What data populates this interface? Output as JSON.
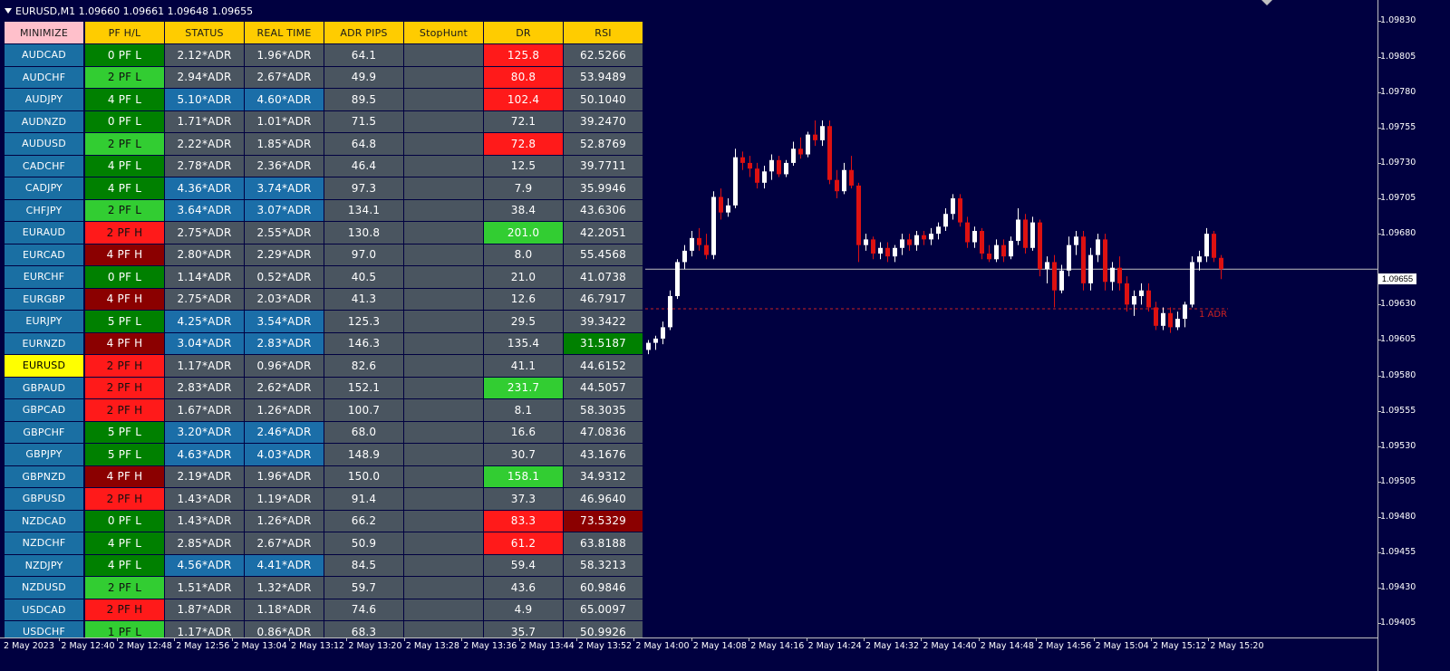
{
  "window": {
    "title": "EURUSD,M1  1.09660 1.09661 1.09648 1.09655"
  },
  "table": {
    "headers": [
      "MINIMIZE",
      "PF H/L",
      "STATUS",
      "REAL TIME",
      "ADR PIPS",
      "StopHunt",
      "DR",
      "RSI"
    ],
    "rows": [
      {
        "symbol": "AUDCAD",
        "pf": "0 PF L",
        "pf_color": "dg",
        "status": "2.12*ADR",
        "status_color": "gray",
        "realtime": "1.96*ADR",
        "realtime_color": "gray",
        "adr": "64.1",
        "stophunt": "",
        "dr": "125.8",
        "dr_color": "red",
        "rsi": "62.5266",
        "rsi_color": "gray"
      },
      {
        "symbol": "AUDCHF",
        "pf": "2 PF L",
        "pf_color": "lg",
        "status": "2.94*ADR",
        "status_color": "gray",
        "realtime": "2.67*ADR",
        "realtime_color": "gray",
        "adr": "49.9",
        "stophunt": "",
        "dr": "80.8",
        "dr_color": "red",
        "rsi": "53.9489",
        "rsi_color": "gray"
      },
      {
        "symbol": "AUDJPY",
        "pf": "4 PF L",
        "pf_color": "dg",
        "status": "5.10*ADR",
        "status_color": "blue",
        "realtime": "4.60*ADR",
        "realtime_color": "blue",
        "adr": "89.5",
        "stophunt": "",
        "dr": "102.4",
        "dr_color": "red",
        "rsi": "50.1040",
        "rsi_color": "gray"
      },
      {
        "symbol": "AUDNZD",
        "pf": "0 PF L",
        "pf_color": "dg",
        "status": "1.71*ADR",
        "status_color": "gray",
        "realtime": "1.01*ADR",
        "realtime_color": "gray",
        "adr": "71.5",
        "stophunt": "",
        "dr": "72.1",
        "dr_color": "gray",
        "rsi": "39.2470",
        "rsi_color": "gray"
      },
      {
        "symbol": "AUDUSD",
        "pf": "2 PF L",
        "pf_color": "lg",
        "status": "2.22*ADR",
        "status_color": "gray",
        "realtime": "1.85*ADR",
        "realtime_color": "gray",
        "adr": "64.8",
        "stophunt": "",
        "dr": "72.8",
        "dr_color": "red",
        "rsi": "52.8769",
        "rsi_color": "gray"
      },
      {
        "symbol": "CADCHF",
        "pf": "4 PF L",
        "pf_color": "dg",
        "status": "2.78*ADR",
        "status_color": "gray",
        "realtime": "2.36*ADR",
        "realtime_color": "gray",
        "adr": "46.4",
        "stophunt": "",
        "dr": "12.5",
        "dr_color": "gray",
        "rsi": "39.7711",
        "rsi_color": "gray"
      },
      {
        "symbol": "CADJPY",
        "pf": "4 PF L",
        "pf_color": "dg",
        "status": "4.36*ADR",
        "status_color": "blue",
        "realtime": "3.74*ADR",
        "realtime_color": "blue",
        "adr": "97.3",
        "stophunt": "",
        "dr": "7.9",
        "dr_color": "gray",
        "rsi": "35.9946",
        "rsi_color": "gray"
      },
      {
        "symbol": "CHFJPY",
        "pf": "2 PF L",
        "pf_color": "lg",
        "status": "3.64*ADR",
        "status_color": "blue",
        "realtime": "3.07*ADR",
        "realtime_color": "blue",
        "adr": "134.1",
        "stophunt": "",
        "dr": "38.4",
        "dr_color": "gray",
        "rsi": "43.6306",
        "rsi_color": "gray"
      },
      {
        "symbol": "EURAUD",
        "pf": "2 PF H",
        "pf_color": "red",
        "status": "2.75*ADR",
        "status_color": "gray",
        "realtime": "2.55*ADR",
        "realtime_color": "gray",
        "adr": "130.8",
        "stophunt": "",
        "dr": "201.0",
        "dr_color": "lg",
        "rsi": "42.2051",
        "rsi_color": "gray"
      },
      {
        "symbol": "EURCAD",
        "pf": "4 PF H",
        "pf_color": "dr",
        "status": "2.80*ADR",
        "status_color": "gray",
        "realtime": "2.29*ADR",
        "realtime_color": "gray",
        "adr": "97.0",
        "stophunt": "",
        "dr": "8.0",
        "dr_color": "gray",
        "rsi": "55.4568",
        "rsi_color": "gray"
      },
      {
        "symbol": "EURCHF",
        "pf": "0 PF L",
        "pf_color": "dg",
        "status": "1.14*ADR",
        "status_color": "gray",
        "realtime": "0.52*ADR",
        "realtime_color": "gray",
        "adr": "40.5",
        "stophunt": "",
        "dr": "21.0",
        "dr_color": "gray",
        "rsi": "41.0738",
        "rsi_color": "gray"
      },
      {
        "symbol": "EURGBP",
        "pf": "4 PF H",
        "pf_color": "dr",
        "status": "2.75*ADR",
        "status_color": "gray",
        "realtime": "2.03*ADR",
        "realtime_color": "gray",
        "adr": "41.3",
        "stophunt": "",
        "dr": "12.6",
        "dr_color": "gray",
        "rsi": "46.7917",
        "rsi_color": "gray"
      },
      {
        "symbol": "EURJPY",
        "pf": "5 PF L",
        "pf_color": "dg",
        "status": "4.25*ADR",
        "status_color": "blue",
        "realtime": "3.54*ADR",
        "realtime_color": "blue",
        "adr": "125.3",
        "stophunt": "",
        "dr": "29.5",
        "dr_color": "gray",
        "rsi": "39.3422",
        "rsi_color": "gray"
      },
      {
        "symbol": "EURNZD",
        "pf": "4 PF H",
        "pf_color": "dr",
        "status": "3.04*ADR",
        "status_color": "blue",
        "realtime": "2.83*ADR",
        "realtime_color": "blue",
        "adr": "146.3",
        "stophunt": "",
        "dr": "135.4",
        "dr_color": "gray",
        "rsi": "31.5187",
        "rsi_color": "dg"
      },
      {
        "symbol": "EURUSD",
        "pf": "2 PF H",
        "pf_color": "red",
        "status": "1.17*ADR",
        "status_color": "gray",
        "realtime": "0.96*ADR",
        "realtime_color": "gray",
        "adr": "82.6",
        "stophunt": "",
        "dr": "41.1",
        "dr_color": "gray",
        "rsi": "44.6152",
        "rsi_color": "gray",
        "active": true
      },
      {
        "symbol": "GBPAUD",
        "pf": "2 PF H",
        "pf_color": "red",
        "status": "2.83*ADR",
        "status_color": "gray",
        "realtime": "2.62*ADR",
        "realtime_color": "gray",
        "adr": "152.1",
        "stophunt": "",
        "dr": "231.7",
        "dr_color": "lg",
        "rsi": "44.5057",
        "rsi_color": "gray"
      },
      {
        "symbol": "GBPCAD",
        "pf": "2 PF H",
        "pf_color": "red",
        "status": "1.67*ADR",
        "status_color": "gray",
        "realtime": "1.26*ADR",
        "realtime_color": "gray",
        "adr": "100.7",
        "stophunt": "",
        "dr": "8.1",
        "dr_color": "gray",
        "rsi": "58.3035",
        "rsi_color": "gray"
      },
      {
        "symbol": "GBPCHF",
        "pf": "5 PF L",
        "pf_color": "dg",
        "status": "3.20*ADR",
        "status_color": "blue",
        "realtime": "2.46*ADR",
        "realtime_color": "blue",
        "adr": "68.0",
        "stophunt": "",
        "dr": "16.6",
        "dr_color": "gray",
        "rsi": "47.0836",
        "rsi_color": "gray"
      },
      {
        "symbol": "GBPJPY",
        "pf": "5 PF L",
        "pf_color": "dg",
        "status": "4.63*ADR",
        "status_color": "blue",
        "realtime": "4.03*ADR",
        "realtime_color": "blue",
        "adr": "148.9",
        "stophunt": "",
        "dr": "30.7",
        "dr_color": "gray",
        "rsi": "43.1676",
        "rsi_color": "gray"
      },
      {
        "symbol": "GBPNZD",
        "pf": "4 PF H",
        "pf_color": "dr",
        "status": "2.19*ADR",
        "status_color": "gray",
        "realtime": "1.96*ADR",
        "realtime_color": "gray",
        "adr": "150.0",
        "stophunt": "",
        "dr": "158.1",
        "dr_color": "lg",
        "rsi": "34.9312",
        "rsi_color": "gray"
      },
      {
        "symbol": "GBPUSD",
        "pf": "2 PF H",
        "pf_color": "red",
        "status": "1.43*ADR",
        "status_color": "gray",
        "realtime": "1.19*ADR",
        "realtime_color": "gray",
        "adr": "91.4",
        "stophunt": "",
        "dr": "37.3",
        "dr_color": "gray",
        "rsi": "46.9640",
        "rsi_color": "gray"
      },
      {
        "symbol": "NZDCAD",
        "pf": "0 PF L",
        "pf_color": "dg",
        "status": "1.43*ADR",
        "status_color": "gray",
        "realtime": "1.26*ADR",
        "realtime_color": "gray",
        "adr": "66.2",
        "stophunt": "",
        "dr": "83.3",
        "dr_color": "red",
        "rsi": "73.5329",
        "rsi_color": "dr"
      },
      {
        "symbol": "NZDCHF",
        "pf": "4 PF L",
        "pf_color": "dg",
        "status": "2.85*ADR",
        "status_color": "gray",
        "realtime": "2.67*ADR",
        "realtime_color": "gray",
        "adr": "50.9",
        "stophunt": "",
        "dr": "61.2",
        "dr_color": "red",
        "rsi": "63.8188",
        "rsi_color": "gray"
      },
      {
        "symbol": "NZDJPY",
        "pf": "4 PF L",
        "pf_color": "dg",
        "status": "4.56*ADR",
        "status_color": "blue",
        "realtime": "4.41*ADR",
        "realtime_color": "blue",
        "adr": "84.5",
        "stophunt": "",
        "dr": "59.4",
        "dr_color": "gray",
        "rsi": "58.3213",
        "rsi_color": "gray"
      },
      {
        "symbol": "NZDUSD",
        "pf": "2 PF L",
        "pf_color": "lg",
        "status": "1.51*ADR",
        "status_color": "gray",
        "realtime": "1.32*ADR",
        "realtime_color": "gray",
        "adr": "59.7",
        "stophunt": "",
        "dr": "43.6",
        "dr_color": "gray",
        "rsi": "60.9846",
        "rsi_color": "gray"
      },
      {
        "symbol": "USDCAD",
        "pf": "2 PF H",
        "pf_color": "red",
        "status": "1.87*ADR",
        "status_color": "gray",
        "realtime": "1.18*ADR",
        "realtime_color": "gray",
        "adr": "74.6",
        "stophunt": "",
        "dr": "4.9",
        "dr_color": "gray",
        "rsi": "65.0097",
        "rsi_color": "gray"
      },
      {
        "symbol": "USDCHF",
        "pf": "1 PF L",
        "pf_color": "lg",
        "status": "1.17*ADR",
        "status_color": "gray",
        "realtime": "0.86*ADR",
        "realtime_color": "gray",
        "adr": "68.3",
        "stophunt": "",
        "dr": "35.7",
        "dr_color": "gray",
        "rsi": "50.9926",
        "rsi_color": "gray"
      }
    ]
  },
  "price_axis": {
    "labels": [
      "1.09830",
      "1.09805",
      "1.09780",
      "1.09755",
      "1.09730",
      "1.09705",
      "1.09680",
      "1.09630",
      "1.09605",
      "1.09580",
      "1.09555",
      "1.09530",
      "1.09505",
      "1.09480",
      "1.09455",
      "1.09430",
      "1.09405"
    ],
    "current_price": "1.09655"
  },
  "time_axis": {
    "labels": [
      "2 May 2023",
      "2 May 12:40",
      "2 May 12:48",
      "2 May 12:56",
      "2 May 13:04",
      "2 May 13:12",
      "2 May 13:20",
      "2 May 13:28",
      "2 May 13:36",
      "2 May 13:44",
      "2 May 13:52",
      "2 May 14:00",
      "2 May 14:08",
      "2 May 14:16",
      "2 May 14:24",
      "2 May 14:32",
      "2 May 14:40",
      "2 May 14:48",
      "2 May 14:56",
      "2 May 15:04",
      "2 May 15:12",
      "2 May 15:20"
    ]
  },
  "annotations": {
    "adr_label": "1 ADR"
  },
  "colors": {
    "chart_bg": "#000040",
    "bull_candle": "#ffffff",
    "bear_candle": "#dd1111",
    "price_line": "#c0c0c0",
    "adr_line": "#cc2222"
  },
  "chart_data": {
    "type": "candlestick",
    "symbol": "EURUSD",
    "timeframe": "M1",
    "ylim": [
      1.09395,
      1.09845
    ],
    "adr_level": 1.09627,
    "current_price": 1.09655,
    "candles": [
      {
        "o": 1.09598,
        "h": 1.09605,
        "l": 1.09595,
        "c": 1.09603
      },
      {
        "o": 1.09603,
        "h": 1.09608,
        "l": 1.09598,
        "c": 1.09606
      },
      {
        "o": 1.09606,
        "h": 1.09618,
        "l": 1.09602,
        "c": 1.09614
      },
      {
        "o": 1.09614,
        "h": 1.0964,
        "l": 1.09612,
        "c": 1.09636
      },
      {
        "o": 1.09636,
        "h": 1.09662,
        "l": 1.09634,
        "c": 1.0966
      },
      {
        "o": 1.0966,
        "h": 1.09672,
        "l": 1.09655,
        "c": 1.09668
      },
      {
        "o": 1.09668,
        "h": 1.09682,
        "l": 1.09664,
        "c": 1.09677
      },
      {
        "o": 1.09677,
        "h": 1.09684,
        "l": 1.09668,
        "c": 1.09672
      },
      {
        "o": 1.09672,
        "h": 1.0968,
        "l": 1.09662,
        "c": 1.09665
      },
      {
        "o": 1.09665,
        "h": 1.0971,
        "l": 1.09662,
        "c": 1.09706
      },
      {
        "o": 1.09706,
        "h": 1.09712,
        "l": 1.0969,
        "c": 1.09695
      },
      {
        "o": 1.09695,
        "h": 1.09705,
        "l": 1.09692,
        "c": 1.097
      },
      {
        "o": 1.097,
        "h": 1.0974,
        "l": 1.09698,
        "c": 1.09734
      },
      {
        "o": 1.09734,
        "h": 1.09738,
        "l": 1.09725,
        "c": 1.0973
      },
      {
        "o": 1.0973,
        "h": 1.09735,
        "l": 1.0972,
        "c": 1.09726
      },
      {
        "o": 1.09726,
        "h": 1.0973,
        "l": 1.09712,
        "c": 1.09716
      },
      {
        "o": 1.09716,
        "h": 1.09728,
        "l": 1.09712,
        "c": 1.09724
      },
      {
        "o": 1.09724,
        "h": 1.09736,
        "l": 1.09718,
        "c": 1.09732
      },
      {
        "o": 1.09732,
        "h": 1.09735,
        "l": 1.0972,
        "c": 1.09722
      },
      {
        "o": 1.09722,
        "h": 1.09732,
        "l": 1.0972,
        "c": 1.0973
      },
      {
        "o": 1.0973,
        "h": 1.09745,
        "l": 1.09728,
        "c": 1.0974
      },
      {
        "o": 1.0974,
        "h": 1.09748,
        "l": 1.09733,
        "c": 1.09736
      },
      {
        "o": 1.09736,
        "h": 1.09752,
        "l": 1.09734,
        "c": 1.0975
      },
      {
        "o": 1.0975,
        "h": 1.0976,
        "l": 1.09742,
        "c": 1.09746
      },
      {
        "o": 1.09746,
        "h": 1.0976,
        "l": 1.09742,
        "c": 1.09756
      },
      {
        "o": 1.09756,
        "h": 1.0976,
        "l": 1.09715,
        "c": 1.09718
      },
      {
        "o": 1.09718,
        "h": 1.09725,
        "l": 1.09705,
        "c": 1.0971
      },
      {
        "o": 1.0971,
        "h": 1.0973,
        "l": 1.09708,
        "c": 1.09725
      },
      {
        "o": 1.09725,
        "h": 1.09735,
        "l": 1.09712,
        "c": 1.09714
      },
      {
        "o": 1.09714,
        "h": 1.09716,
        "l": 1.0966,
        "c": 1.09672
      },
      {
        "o": 1.09672,
        "h": 1.0968,
        "l": 1.09668,
        "c": 1.09676
      },
      {
        "o": 1.09676,
        "h": 1.09678,
        "l": 1.09662,
        "c": 1.09666
      },
      {
        "o": 1.09666,
        "h": 1.09674,
        "l": 1.09662,
        "c": 1.0967
      },
      {
        "o": 1.0967,
        "h": 1.09674,
        "l": 1.0966,
        "c": 1.09664
      },
      {
        "o": 1.09664,
        "h": 1.09672,
        "l": 1.0966,
        "c": 1.0967
      },
      {
        "o": 1.0967,
        "h": 1.0968,
        "l": 1.09665,
        "c": 1.09676
      },
      {
        "o": 1.09676,
        "h": 1.0968,
        "l": 1.09668,
        "c": 1.09672
      },
      {
        "o": 1.09672,
        "h": 1.09682,
        "l": 1.09668,
        "c": 1.09679
      },
      {
        "o": 1.09679,
        "h": 1.09682,
        "l": 1.09672,
        "c": 1.09676
      },
      {
        "o": 1.09676,
        "h": 1.09684,
        "l": 1.09672,
        "c": 1.0968
      },
      {
        "o": 1.0968,
        "h": 1.09688,
        "l": 1.09676,
        "c": 1.09685
      },
      {
        "o": 1.09685,
        "h": 1.09698,
        "l": 1.09682,
        "c": 1.09694
      },
      {
        "o": 1.09694,
        "h": 1.09708,
        "l": 1.0969,
        "c": 1.09705
      },
      {
        "o": 1.09705,
        "h": 1.09708,
        "l": 1.09685,
        "c": 1.09688
      },
      {
        "o": 1.09688,
        "h": 1.09692,
        "l": 1.0967,
        "c": 1.09674
      },
      {
        "o": 1.09674,
        "h": 1.09685,
        "l": 1.0967,
        "c": 1.09682
      },
      {
        "o": 1.09682,
        "h": 1.09684,
        "l": 1.09662,
        "c": 1.09666
      },
      {
        "o": 1.09666,
        "h": 1.09672,
        "l": 1.0966,
        "c": 1.09662
      },
      {
        "o": 1.09662,
        "h": 1.09676,
        "l": 1.0966,
        "c": 1.09672
      },
      {
        "o": 1.09672,
        "h": 1.09676,
        "l": 1.0966,
        "c": 1.09664
      },
      {
        "o": 1.09664,
        "h": 1.09678,
        "l": 1.09662,
        "c": 1.09675
      },
      {
        "o": 1.09675,
        "h": 1.09698,
        "l": 1.09672,
        "c": 1.0969
      },
      {
        "o": 1.0969,
        "h": 1.09694,
        "l": 1.09666,
        "c": 1.0967
      },
      {
        "o": 1.0967,
        "h": 1.09692,
        "l": 1.09668,
        "c": 1.09688
      },
      {
        "o": 1.09688,
        "h": 1.0969,
        "l": 1.0965,
        "c": 1.09655
      },
      {
        "o": 1.09655,
        "h": 1.09664,
        "l": 1.09645,
        "c": 1.0966
      },
      {
        "o": 1.0966,
        "h": 1.09665,
        "l": 1.09628,
        "c": 1.0964
      },
      {
        "o": 1.0964,
        "h": 1.09658,
        "l": 1.09638,
        "c": 1.09654
      },
      {
        "o": 1.09654,
        "h": 1.09678,
        "l": 1.0965,
        "c": 1.09672
      },
      {
        "o": 1.09672,
        "h": 1.09682,
        "l": 1.09665,
        "c": 1.09678
      },
      {
        "o": 1.09678,
        "h": 1.09682,
        "l": 1.0964,
        "c": 1.09645
      },
      {
        "o": 1.09645,
        "h": 1.0967,
        "l": 1.0964,
        "c": 1.09665
      },
      {
        "o": 1.09665,
        "h": 1.0968,
        "l": 1.0966,
        "c": 1.09676
      },
      {
        "o": 1.09676,
        "h": 1.0968,
        "l": 1.0964,
        "c": 1.09646
      },
      {
        "o": 1.09646,
        "h": 1.0966,
        "l": 1.0964,
        "c": 1.09656
      },
      {
        "o": 1.09656,
        "h": 1.09664,
        "l": 1.0964,
        "c": 1.09645
      },
      {
        "o": 1.09645,
        "h": 1.0965,
        "l": 1.09625,
        "c": 1.0963
      },
      {
        "o": 1.0963,
        "h": 1.0964,
        "l": 1.09622,
        "c": 1.09636
      },
      {
        "o": 1.09636,
        "h": 1.09645,
        "l": 1.0963,
        "c": 1.0964
      },
      {
        "o": 1.0964,
        "h": 1.09645,
        "l": 1.09625,
        "c": 1.09628
      },
      {
        "o": 1.09628,
        "h": 1.09632,
        "l": 1.09612,
        "c": 1.09615
      },
      {
        "o": 1.09615,
        "h": 1.09628,
        "l": 1.09612,
        "c": 1.09624
      },
      {
        "o": 1.09624,
        "h": 1.09628,
        "l": 1.0961,
        "c": 1.09614
      },
      {
        "o": 1.09614,
        "h": 1.09625,
        "l": 1.09612,
        "c": 1.0962
      },
      {
        "o": 1.0962,
        "h": 1.09632,
        "l": 1.09614,
        "c": 1.0963
      },
      {
        "o": 1.0963,
        "h": 1.09664,
        "l": 1.09628,
        "c": 1.0966
      },
      {
        "o": 1.0966,
        "h": 1.09668,
        "l": 1.09654,
        "c": 1.09664
      },
      {
        "o": 1.09664,
        "h": 1.09684,
        "l": 1.0966,
        "c": 1.0968
      },
      {
        "o": 1.0968,
        "h": 1.09682,
        "l": 1.0966,
        "c": 1.09663
      },
      {
        "o": 1.09663,
        "h": 1.09665,
        "l": 1.09648,
        "c": 1.09655
      }
    ]
  }
}
